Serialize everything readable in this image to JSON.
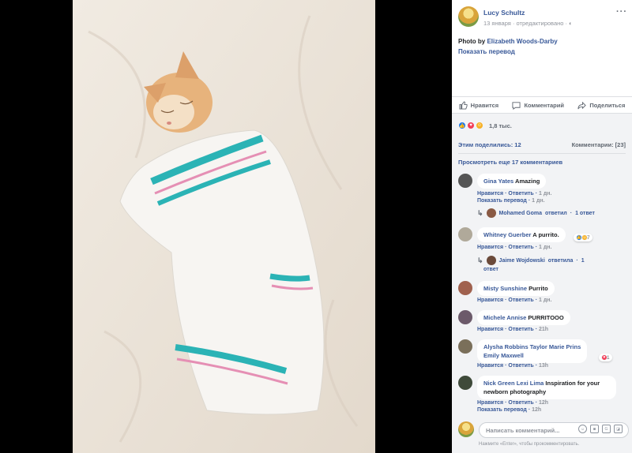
{
  "post": {
    "author": "Lucy Schultz",
    "date": "13 января",
    "edited": "отредактировано",
    "text_prefix": "Photo by",
    "photographer": "Elizabeth Woods-Darby",
    "translate": "Показать перевод"
  },
  "actions": {
    "like": "Нравится",
    "comment": "Комментарий",
    "share": "Поделиться"
  },
  "reactions": {
    "count": "1,8 тыс."
  },
  "stats": {
    "shares": "Этим поделились: 12",
    "comments": "Комментарии: [23]"
  },
  "view_more": "Просмотреть еще 17 комментариев",
  "comments": [
    {
      "name": "Gina Yates",
      "text": "Amazing",
      "like": "Нравится",
      "reply": "Ответить",
      "time": "1 дн.",
      "translate": "Показать перевод",
      "reply_author": "Mohamed Goma",
      "reply_verb": "ответил",
      "reply_count": "1 ответ"
    },
    {
      "name": "Whitney Guerber",
      "text": "A purrito.",
      "reactions": "7",
      "like": "Нравится",
      "reply": "Ответить",
      "time": "1 дн.",
      "reply_author": "Jaime Wojdowski",
      "reply_verb": "ответила",
      "reply_count_1": "1",
      "reply_count_2": "ответ"
    },
    {
      "name": "Misty Sunshine",
      "text": "Purrito",
      "like": "Нравится",
      "reply": "Ответить",
      "time": "1 дн."
    },
    {
      "name": "Michele Annise",
      "text": "PURRITOOO",
      "like": "Нравится",
      "reply": "Ответить",
      "time": "21h"
    },
    {
      "name": "Alysha Robbins",
      "tag1": "Taylor Marie Prins",
      "tag2": "Emily Maxwell",
      "reactions": "1",
      "like": "Нравится",
      "reply": "Ответить",
      "time": "13h"
    },
    {
      "name": "Nick Green",
      "tag1": "Lexi Lima",
      "text": "Inspiration for your newborn photography",
      "like": "Нравится",
      "reply": "Ответить",
      "time": "12h",
      "translate": "Показать перевод"
    }
  ],
  "compose": {
    "placeholder": "Написать комментарий...",
    "hint": "Нажмите «Enter», чтобы прокомментировать."
  },
  "colors": {
    "link": "#385898",
    "muted": "#90949c",
    "panel_gray": "#f2f3f5"
  }
}
